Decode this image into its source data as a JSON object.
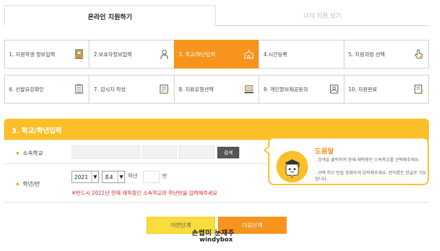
{
  "tabs": {
    "active": "온라인 지원하기",
    "inactive": "나의 지원 보기"
  },
  "steps": [
    {
      "label": "1. 지원학생 정보입력",
      "icon": "document-icon"
    },
    {
      "label": "2.보호자정보입력",
      "icon": "person-icon"
    },
    {
      "label": "3. 학교/학년입력",
      "icon": "school-icon",
      "active": true
    },
    {
      "label": "4.시간등록",
      "icon": "",
      "active": false
    },
    {
      "label": "5. 지원과정 선택",
      "icon": "pointer-icon"
    },
    {
      "label": "6. 선발요강확인",
      "icon": "checklist-icon"
    },
    {
      "label": "7. 감시지 작성",
      "icon": "form-icon"
    },
    {
      "label": "8. 지원유형선택",
      "icon": "laptop-icon"
    },
    {
      "label": "9. 개인정보제공동의",
      "icon": "id-card-icon"
    },
    {
      "label": "10. 지원완료",
      "icon": "complete-icon"
    }
  ],
  "section": {
    "title": "3. 학교/학년입력"
  },
  "school_row": {
    "label": "소속학교",
    "search_button": "검색"
  },
  "grade_row": {
    "label": "학년/반",
    "year": "2021",
    "school_type": "초4",
    "grade_text": "학년",
    "class_text": "반",
    "warning": "※반드시 2021년 현재 재학중인 소속학교와 학년반을 입력해주세요"
  },
  "help": {
    "title": "도움말",
    "line1": "- 검색을 클릭하여 현재 재학중인 소속학교를 선택해주세요.",
    "line2": "- 선택 하신 반을 정확하게 입력해주세요. 반이름은 한글로 가능합니다."
  },
  "buttons": {
    "prev": "이전단계",
    "next": "다음단계"
  },
  "watermark": {
    "line1": "손썹미 눈재주",
    "line2": "windybox"
  },
  "colors": {
    "accent_orange": "#f7941d",
    "accent_yellow": "#fbbf2a",
    "warning_red": "#d9262a"
  }
}
